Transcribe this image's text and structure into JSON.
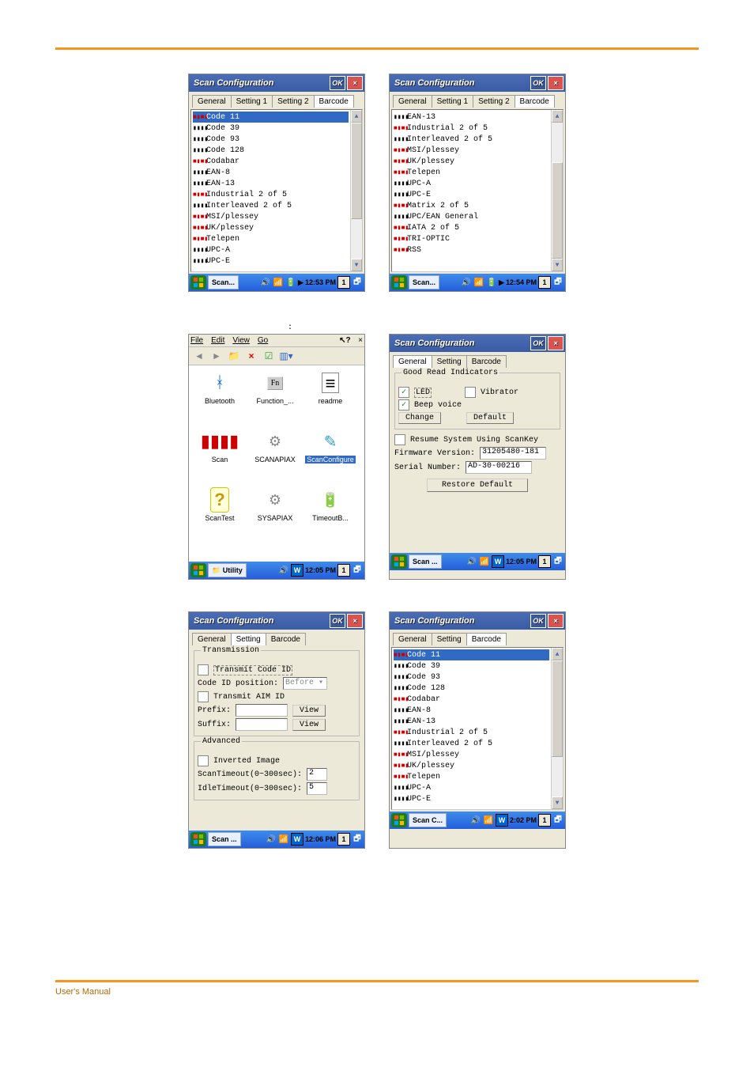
{
  "windows": {
    "scanconfig_title": "Scan Configuration",
    "ok": "OK",
    "close": "×"
  },
  "tabs4": [
    "General",
    "Setting 1",
    "Setting 2",
    "Barcode"
  ],
  "tabs3": [
    "General",
    "Setting",
    "Barcode"
  ],
  "barcodes_a": [
    {
      "t": "Code 11",
      "c": "red",
      "sel": true
    },
    {
      "t": "Code 39",
      "c": "blk"
    },
    {
      "t": "Code 93",
      "c": "blk"
    },
    {
      "t": "Code 128",
      "c": "blk"
    },
    {
      "t": "Codabar",
      "c": "red"
    },
    {
      "t": "EAN-8",
      "c": "blk"
    },
    {
      "t": "EAN-13",
      "c": "blk"
    },
    {
      "t": "Industrial 2 of 5",
      "c": "red"
    },
    {
      "t": "Interleaved 2 of 5",
      "c": "blk"
    },
    {
      "t": "MSI/plessey",
      "c": "red"
    },
    {
      "t": "UK/plessey",
      "c": "red"
    },
    {
      "t": "Telepen",
      "c": "red"
    },
    {
      "t": "UPC-A",
      "c": "blk"
    },
    {
      "t": "UPC-E",
      "c": "blk"
    }
  ],
  "barcodes_b": [
    {
      "t": "EAN-13",
      "c": "blk"
    },
    {
      "t": "Industrial 2 of 5",
      "c": "red"
    },
    {
      "t": "Interleaved 2 of 5",
      "c": "blk"
    },
    {
      "t": "MSI/plessey",
      "c": "red"
    },
    {
      "t": "UK/plessey",
      "c": "red"
    },
    {
      "t": "Telepen",
      "c": "red"
    },
    {
      "t": "UPC-A",
      "c": "blk"
    },
    {
      "t": "UPC-E",
      "c": "blk"
    },
    {
      "t": "Matrix 2 of 5",
      "c": "red"
    },
    {
      "t": "UPC/EAN General",
      "c": "blk"
    },
    {
      "t": "IATA 2 of 5",
      "c": "red"
    },
    {
      "t": "TRI-OPTIC",
      "c": "red"
    },
    {
      "t": "RSS",
      "c": "red"
    }
  ],
  "taskbar": {
    "scan": "Scan...",
    "scan_short": "Scan ...",
    "scan_c": "Scan C...",
    "utility": "Utility",
    "t1253": "12:53 PM",
    "t1254": "12:54 PM",
    "t1205": "12:05 PM",
    "t1206": "12:06 PM",
    "t202": "2:02 PM",
    "one": "1"
  },
  "explorer": {
    "menu": [
      "File",
      "Edit",
      "View",
      "Go"
    ],
    "help": "?",
    "x": "×",
    "icons": [
      {
        "lbl": "Bluetooth",
        "gly": "bt"
      },
      {
        "lbl": "Function_...",
        "gly": "fn"
      },
      {
        "lbl": "readme",
        "gly": "txt"
      },
      {
        "lbl": "Scan",
        "gly": "bar"
      },
      {
        "lbl": "SCANAPIAX",
        "gly": "dll"
      },
      {
        "lbl": "ScanConfigure",
        "gly": "wand",
        "sel": true
      },
      {
        "lbl": "ScanTest",
        "gly": "q"
      },
      {
        "lbl": "SYSAPIAX",
        "gly": "dll"
      },
      {
        "lbl": "TimeoutB...",
        "gly": "bat"
      }
    ]
  },
  "general": {
    "good_read": "Good Read Indicators",
    "led": "LED",
    "vibrator": "Vibrator",
    "beep": "Beep voice",
    "change": "Change",
    "default": "Default",
    "resume": "Resume System Using ScanKey",
    "fw_label": "Firmware Version:",
    "fw_val": "31205480-181",
    "sn_label": "Serial Number:",
    "sn_val": "AD-30-00216",
    "restore": "Restore Default"
  },
  "setting": {
    "transmission": "Transmission",
    "tx_code_id": "Transmit Code ID",
    "code_id_pos": "Code ID position:",
    "before": "Before",
    "tx_aim_id": "Transmit AIM ID",
    "prefix": "Prefix:",
    "suffix": "Suffix:",
    "view": "View",
    "advanced": "Advanced",
    "inv_image": "Inverted Image",
    "scan_to": "ScanTimeout(0~300sec):",
    "scan_to_val": "2",
    "idle_to": "IdleTimeout(0~300sec):",
    "idle_to_val": "5"
  },
  "barcodes_c": [
    {
      "t": "Code 11",
      "c": "red",
      "sel": true
    },
    {
      "t": "Code 39",
      "c": "blk"
    },
    {
      "t": "Code 93",
      "c": "blk"
    },
    {
      "t": "Code 128",
      "c": "blk"
    },
    {
      "t": "Codabar",
      "c": "red"
    },
    {
      "t": "EAN-8",
      "c": "blk"
    },
    {
      "t": "EAN-13",
      "c": "blk"
    },
    {
      "t": "Industrial 2 of 5",
      "c": "red"
    },
    {
      "t": "Interleaved 2 of 5",
      "c": "blk"
    },
    {
      "t": "MSI/plessey",
      "c": "red"
    },
    {
      "t": "UK/plessey",
      "c": "red"
    },
    {
      "t": "Telepen",
      "c": "red"
    },
    {
      "t": "UPC-A",
      "c": "blk"
    },
    {
      "t": "UPC-E",
      "c": "blk"
    }
  ],
  "caption_colon": ":",
  "footer": "User's Manual"
}
